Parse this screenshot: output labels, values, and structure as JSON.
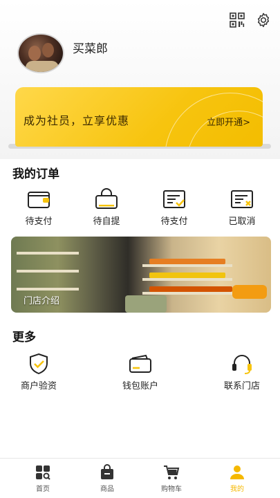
{
  "profile": {
    "username": "买菜郎"
  },
  "vip": {
    "title": "成为社员，立享优惠",
    "open_label": "立即开通>"
  },
  "orders": {
    "title": "我的订单",
    "items": [
      {
        "label": "待支付",
        "icon": "wallet-icon"
      },
      {
        "label": "待自提",
        "icon": "shopping-bag-icon"
      },
      {
        "label": "待支付",
        "icon": "document-check-icon"
      },
      {
        "label": "已取消",
        "icon": "document-cancel-icon"
      }
    ]
  },
  "store": {
    "label": "门店介绍"
  },
  "more": {
    "title": "更多",
    "items": [
      {
        "label": "商户验资",
        "icon": "shield-check-icon"
      },
      {
        "label": "钱包账户",
        "icon": "card-wallet-icon"
      },
      {
        "label": "联系门店",
        "icon": "headset-icon"
      }
    ]
  },
  "tabbar": {
    "items": [
      {
        "label": "首页",
        "icon": "home-grid-icon"
      },
      {
        "label": "商品",
        "icon": "bag-icon"
      },
      {
        "label": "购物车",
        "icon": "cart-icon"
      },
      {
        "label": "我的",
        "icon": "user-icon"
      }
    ],
    "active_index": 3
  },
  "colors": {
    "accent": "#f7c40f",
    "dark_text": "#222222"
  }
}
